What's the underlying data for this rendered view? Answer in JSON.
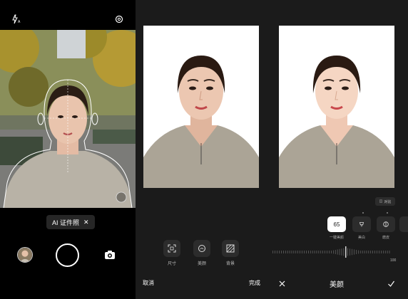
{
  "camera": {
    "flash_icon": "flash-auto-icon",
    "settings_icon": "gear-icon",
    "mode_chip_label": "AI 证件照",
    "mode_chip_close": "✕",
    "switch_icon": "camera-switch-icon"
  },
  "result": {
    "tools": [
      {
        "label": "尺寸",
        "icon": "crop-frame-icon"
      },
      {
        "label": "美颜",
        "icon": "beauty-icon"
      },
      {
        "label": "背景",
        "icon": "background-pattern-icon"
      }
    ],
    "cancel_label": "取消",
    "done_label": "完成"
  },
  "beauty": {
    "compare_label": "对比",
    "options": [
      {
        "value": "65",
        "label": "一键美颜",
        "active": true
      },
      {
        "value": "",
        "label": "美白",
        "icon": "whitening-icon"
      },
      {
        "value": "",
        "label": "磨皮",
        "icon": "smoothing-icon"
      },
      {
        "value": "",
        "label": "",
        "icon": "more-icon"
      }
    ],
    "slider_max": "100",
    "slider_value": 65,
    "title": "美颜",
    "close_icon": "close-icon",
    "confirm_icon": "check-icon"
  },
  "colors": {
    "background": "#121212",
    "panel": "#1b1b1b",
    "chip": "#2c2c2c",
    "accent": "#ffffff"
  }
}
